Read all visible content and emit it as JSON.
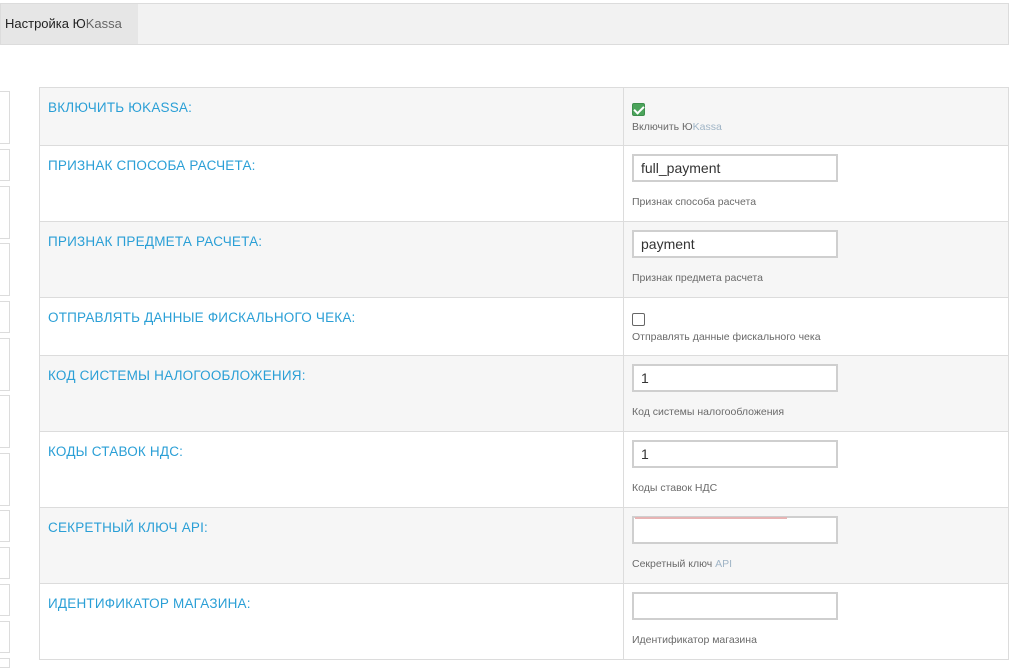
{
  "tabs": [
    {
      "label_main": "Настройка Ю",
      "label_suffix": "Kassa"
    }
  ],
  "settings": [
    {
      "label": "Включить ЮKassa:",
      "type": "checkbox",
      "checked": true,
      "hint_main": "Включить Ю",
      "hint_suffix": "Kassa"
    },
    {
      "label": "Признак способа расчета:",
      "type": "text",
      "value": "full_payment",
      "hint_main": "Признак способа расчета",
      "hint_suffix": ""
    },
    {
      "label": "Признак предмета расчета:",
      "type": "text",
      "value": "payment",
      "hint_main": "Признак предмета расчета",
      "hint_suffix": ""
    },
    {
      "label": "Отправлять данные фискального чека:",
      "type": "checkbox",
      "checked": false,
      "hint_main": "Отправлять данные фискального чека",
      "hint_suffix": ""
    },
    {
      "label": "Код системы налогообложения:",
      "type": "text",
      "value": "1",
      "hint_main": "Код системы налогообложения",
      "hint_suffix": ""
    },
    {
      "label": "Коды ставок НДС:",
      "type": "text",
      "value": "1",
      "hint_main": "Коды ставок НДС",
      "hint_suffix": ""
    },
    {
      "label": "Секретный ключ API:",
      "type": "secret",
      "value": "",
      "hint_main": "Секретный ключ ",
      "hint_suffix": "API"
    },
    {
      "label": "Идентификатор магазина:",
      "type": "text",
      "value": "",
      "hint_main": "Идентификатор магазина",
      "hint_suffix": ""
    }
  ],
  "colors": {
    "label_blue": "#2a9fd6",
    "checkbox_green": "#4ba45b"
  }
}
